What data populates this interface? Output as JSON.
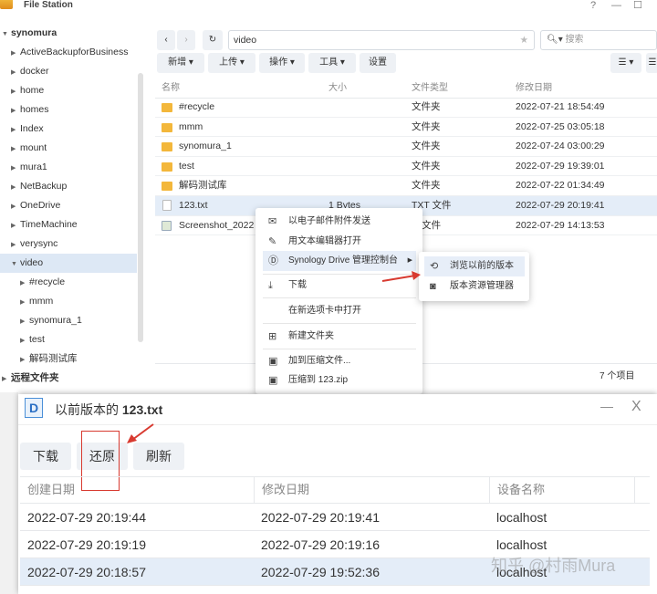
{
  "window": {
    "title": "File Station",
    "help": "?",
    "minimize": "—",
    "maximize": "☐"
  },
  "sidebar": {
    "root": "synomura",
    "items": [
      "ActiveBackupforBusiness",
      "docker",
      "home",
      "homes",
      "Index",
      "mount",
      "mura1",
      "NetBackup",
      "OneDrive",
      "TimeMachine",
      "verysync",
      "video"
    ],
    "video_children": [
      "#recycle",
      "mmm",
      "synomura_1",
      "test",
      "解码测试库"
    ],
    "remote": "远程文件夹"
  },
  "toolbar": {
    "path": "video",
    "search_placeholder": "搜索",
    "buttons": [
      "新增 ▾",
      "上传 ▾",
      "操作 ▾",
      "工具 ▾",
      "设置"
    ]
  },
  "columns": [
    "名称",
    "大小",
    "文件类型",
    "修改日期"
  ],
  "files": [
    {
      "name": "#recycle",
      "size": "",
      "type": "文件夹",
      "date": "2022-07-21 18:54:49",
      "icon": "recycle"
    },
    {
      "name": "mmm",
      "size": "",
      "type": "文件夹",
      "date": "2022-07-25 03:05:18",
      "icon": "folder"
    },
    {
      "name": "synomura_1",
      "size": "",
      "type": "文件夹",
      "date": "2022-07-24 03:00:29",
      "icon": "folder"
    },
    {
      "name": "test",
      "size": "",
      "type": "文件夹",
      "date": "2022-07-29 19:39:01",
      "icon": "folder"
    },
    {
      "name": "解码测试库",
      "size": "",
      "type": "文件夹",
      "date": "2022-07-22 01:34:49",
      "icon": "folder"
    },
    {
      "name": "123.txt",
      "size": "1 Bytes",
      "type": "TXT 文件",
      "date": "2022-07-29 20:19:41",
      "icon": "doc"
    },
    {
      "name": "Screenshot_2022",
      "size": "",
      "type": "G 文件",
      "date": "2022-07-29 14:13:53",
      "icon": "img"
    }
  ],
  "status": "7 个项目",
  "context_menu": [
    "以电子邮件附件发送",
    "用文本编辑器打开",
    "Synology Drive 管理控制台",
    "下载",
    "在新选项卡中打开",
    "新建文件夹",
    "加到压缩文件...",
    "压缩到 123.zip"
  ],
  "submenu": [
    "浏览以前的版本",
    "版本资源管理器"
  ],
  "dialog": {
    "title_prefix": "以前版本的",
    "title_file": "123.txt",
    "minimize": "—",
    "close": "X",
    "buttons": [
      "下载",
      "还原",
      "刷新"
    ],
    "columns": [
      "创建日期",
      "修改日期",
      "设备名称"
    ],
    "rows": [
      [
        "2022-07-29 20:19:44",
        "2022-07-29 20:19:41",
        "localhost"
      ],
      [
        "2022-07-29 20:19:19",
        "2022-07-29 20:19:16",
        "localhost"
      ],
      [
        "2022-07-29 20:18:57",
        "2022-07-29 19:52:36",
        "localhost"
      ]
    ]
  },
  "watermark": "知乎 @村雨Mura",
  "colors": {
    "accent": "#3b7bd4",
    "selection": "#e4edf8",
    "annotation": "#d83a30"
  }
}
